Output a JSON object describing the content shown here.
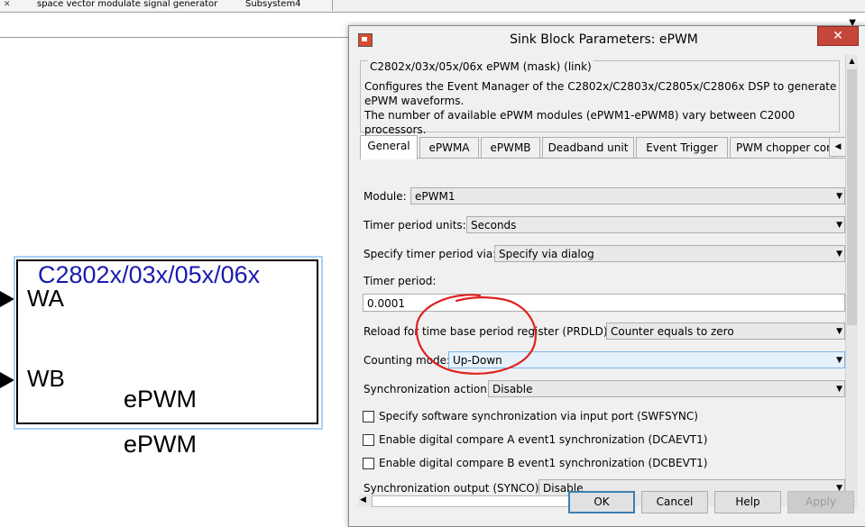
{
  "model_tabs": [
    {
      "label": "space vector modulate signal generator"
    },
    {
      "label": "Subsystem4"
    }
  ],
  "block": {
    "title": "C2802x/03x/05x/06x",
    "inports": [
      "WA",
      "WB"
    ],
    "inner_name": "ePWM",
    "name": "ePWM"
  },
  "dialog": {
    "title": "Sink Block Parameters: ePWM",
    "close_symbol": "✕",
    "group_title": "C2802x/03x/05x/06x ePWM (mask) (link)",
    "description": [
      "Configures the Event Manager of the C2802x/C2803x/C2805x/C2806x DSP to generate",
      "ePWM waveforms.",
      "The number of available ePWM modules (ePWM1-ePWM8) vary between C2000 processors."
    ],
    "tabs": [
      {
        "label": "General"
      },
      {
        "label": "ePWMA"
      },
      {
        "label": "ePWMB"
      },
      {
        "label": "Deadband unit"
      },
      {
        "label": "Event Trigger"
      },
      {
        "label": "PWM chopper cor"
      }
    ],
    "params": {
      "module_label": "Module:",
      "module_value": "ePWM1",
      "timer_units_label": "Timer period units:",
      "timer_units_value": "Seconds",
      "spec_via_label": "Specify timer period via:",
      "spec_via_value": "Specify via dialog",
      "timer_period_label": "Timer period:",
      "timer_period_value": "0.0001",
      "reload_label": "Reload for time base period register (PRDLD):",
      "reload_value": "Counter equals to zero",
      "counting_label": "Counting mode:",
      "counting_value": "Up-Down",
      "sync_action_label": "Synchronization action:",
      "sync_action_value": "Disable",
      "chk1_label": "Specify software synchronization via input port (SWFSYNC)",
      "chk2_label": "Enable digital compare A event1 synchronization (DCAEVT1)",
      "chk3_label": "Enable digital compare B event1 synchronization (DCBEVT1)",
      "sync_out_label": "Synchronization output (SYNCO):",
      "sync_out_value": "Disable"
    },
    "buttons": {
      "ok": "OK",
      "cancel": "Cancel",
      "help": "Help",
      "apply": "Apply"
    }
  },
  "colors": {
    "block_title": "#1a1ab0",
    "annotation": "#e02020",
    "close_button": "#c7463a"
  }
}
